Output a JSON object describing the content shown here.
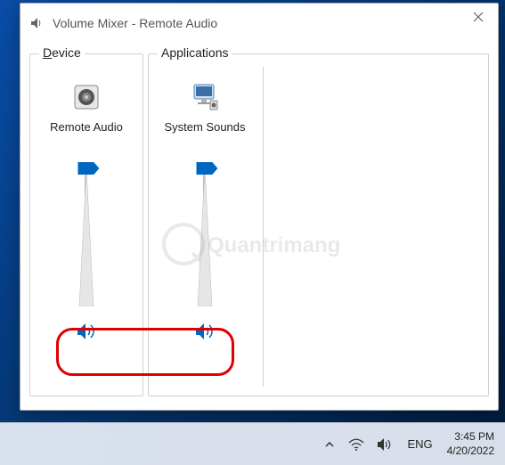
{
  "window": {
    "title": "Volume Mixer - Remote Audio"
  },
  "device_panel": {
    "label_first": "D",
    "label_rest": "evice"
  },
  "apps_panel": {
    "label": "Applications"
  },
  "device": {
    "name": "Remote Audio",
    "volume": 100,
    "muted": false
  },
  "apps": [
    {
      "name": "System Sounds",
      "volume": 100,
      "muted": false
    }
  ],
  "taskbar": {
    "lang": "ENG",
    "time": "3:45 PM",
    "date": "4/20/2022"
  },
  "watermark": "Quantrimang",
  "colors": {
    "accent": "#0067c0",
    "highlight": "#e00000"
  }
}
